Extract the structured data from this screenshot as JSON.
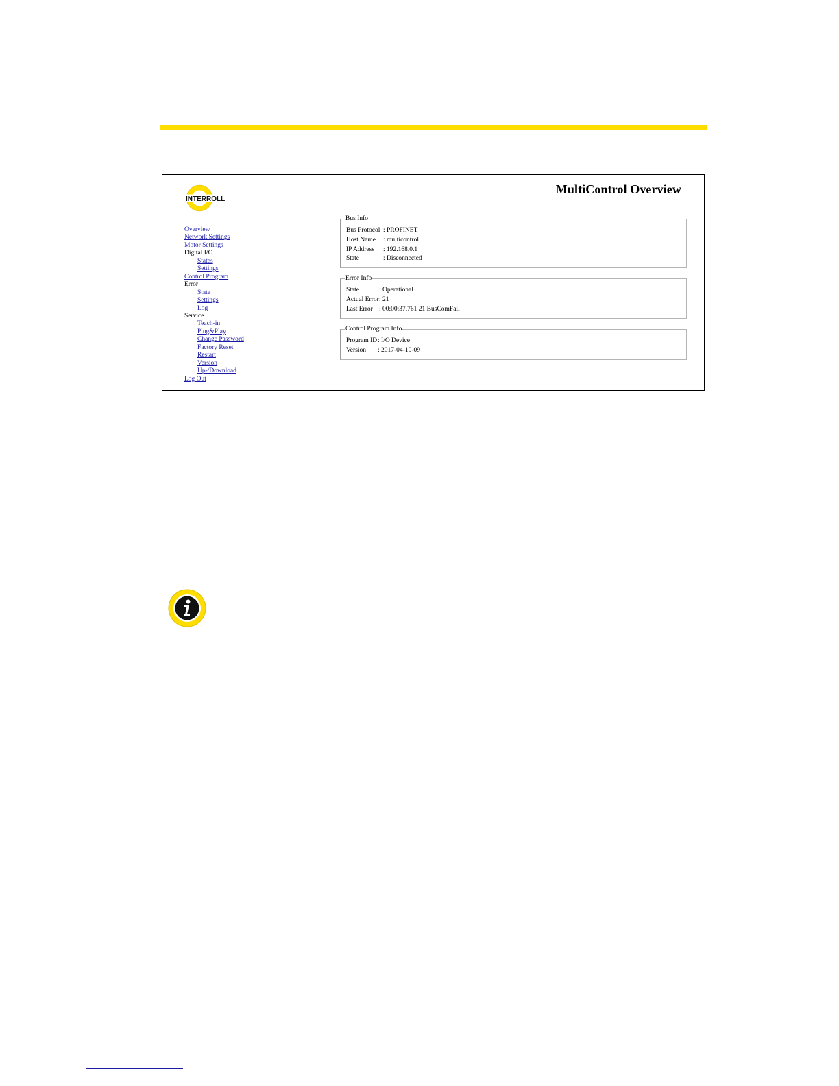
{
  "header": {
    "title": "MultiControl Overview",
    "logo_text": "INTERROLL"
  },
  "nav": {
    "items": [
      {
        "label": "Overview",
        "link": true,
        "level": 0
      },
      {
        "label": "Network Settings",
        "link": true,
        "level": 0
      },
      {
        "label": "Motor Settings",
        "link": true,
        "level": 0
      },
      {
        "label": "Digital I/O",
        "link": false,
        "level": 0
      },
      {
        "label": "States",
        "link": true,
        "level": 1
      },
      {
        "label": "Settings",
        "link": true,
        "level": 1
      },
      {
        "label": "Control Program",
        "link": true,
        "level": 0
      },
      {
        "label": "Error",
        "link": false,
        "level": 0
      },
      {
        "label": "State",
        "link": true,
        "level": 1
      },
      {
        "label": "Settings",
        "link": true,
        "level": 1
      },
      {
        "label": "Log",
        "link": true,
        "level": 1
      },
      {
        "label": "Service",
        "link": false,
        "level": 0
      },
      {
        "label": "Teach-in",
        "link": true,
        "level": 1
      },
      {
        "label": "Plug&Play",
        "link": true,
        "level": 1
      },
      {
        "label": "Change Password",
        "link": true,
        "level": 1
      },
      {
        "label": "Factory Reset",
        "link": true,
        "level": 1
      },
      {
        "label": "Restart",
        "link": true,
        "level": 1
      },
      {
        "label": "Version",
        "link": true,
        "level": 1
      },
      {
        "label": "Up-/Download",
        "link": true,
        "level": 1
      },
      {
        "label": "Log Out",
        "link": true,
        "level": 0
      }
    ]
  },
  "bus_info": {
    "legend": "Bus Info",
    "rows": [
      {
        "key": "Bus Protocol",
        "value": ": PROFINET"
      },
      {
        "key": "Host Name",
        "value": ": multicontrol"
      },
      {
        "key": "IP Address",
        "value": ": 192.168.0.1"
      },
      {
        "key": "State",
        "value": ": Disconnected"
      }
    ]
  },
  "error_info": {
    "legend": "Error Info",
    "rows": [
      {
        "key": "State",
        "value": ": Operational"
      },
      {
        "key": "Actual Error",
        "value": ": 21"
      },
      {
        "key": "Last Error",
        "value": ": 00:00:37.761 21 BusComFail"
      }
    ]
  },
  "control_program_info": {
    "legend": "Control Program Info",
    "rows": [
      {
        "key": "Program ID",
        "value": ": I/O Device"
      },
      {
        "key": "Version",
        "value": ": 2017-04-10-09"
      }
    ]
  },
  "colors": {
    "accent_yellow": "#ffdd00",
    "link": "#1a1aa6",
    "border": "#b5b5b5"
  },
  "icons": {
    "info": "info-icon",
    "logo": "interroll-logo-icon"
  }
}
